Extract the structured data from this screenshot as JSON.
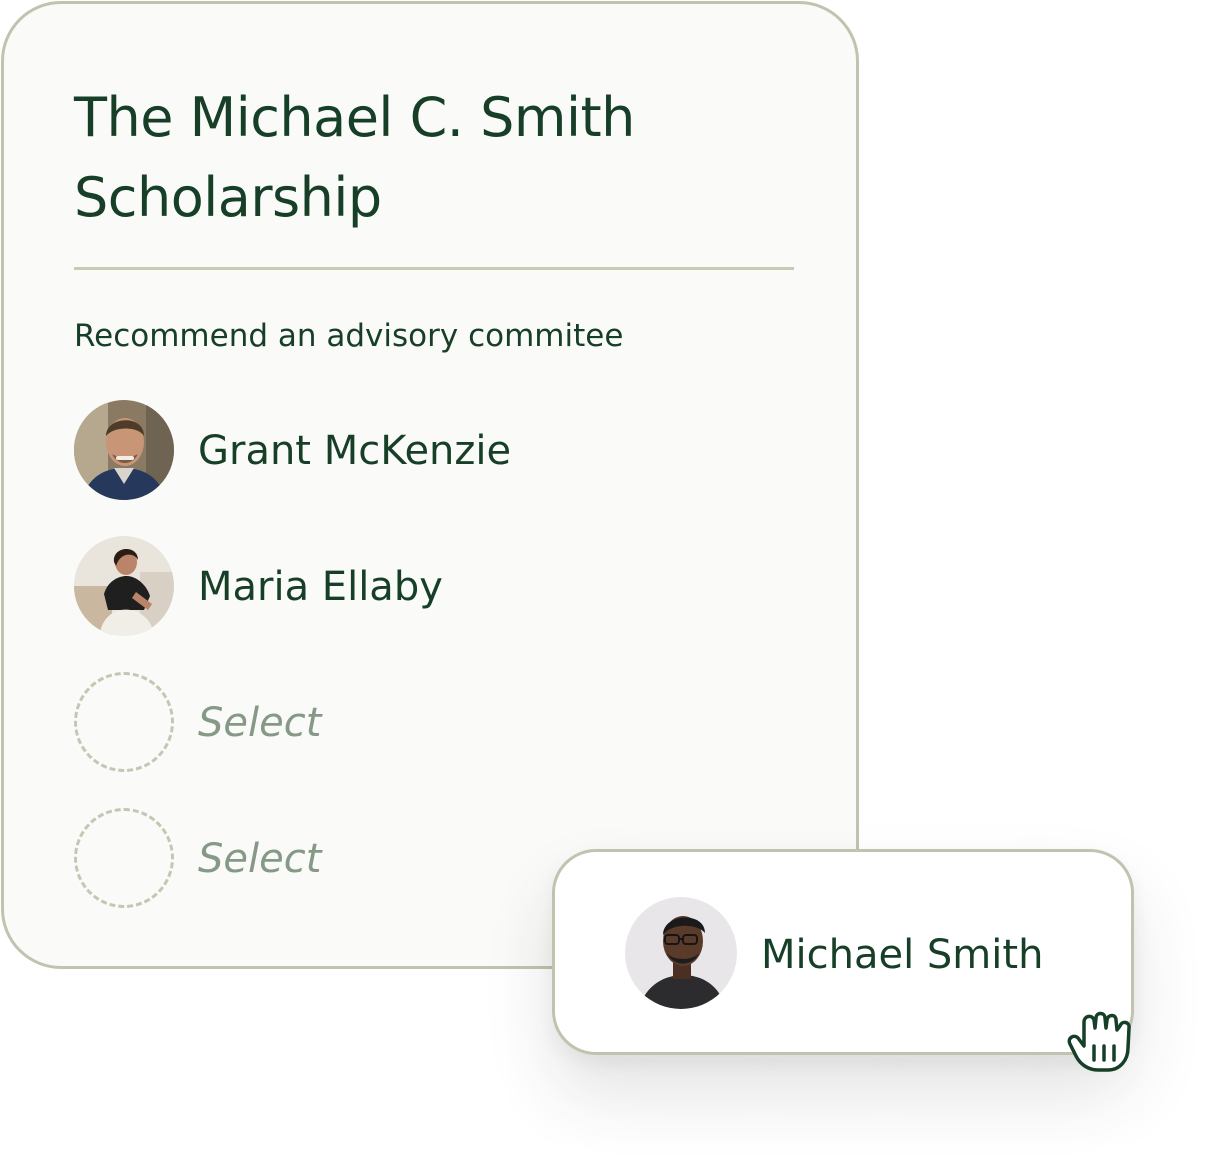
{
  "card": {
    "title": "The Michael C. Smith Scholarship",
    "subtitle": "Recommend an advisory commitee",
    "members": [
      {
        "name": "Grant McKenzie",
        "avatar_icon": "avatar-photo"
      },
      {
        "name": "Maria Ellaby",
        "avatar_icon": "avatar-photo"
      }
    ],
    "empty_slots": [
      {
        "label": "Select"
      },
      {
        "label": "Select"
      }
    ]
  },
  "dragged_item": {
    "name": "Michael Smith",
    "avatar_icon": "avatar-photo",
    "cursor_icon": "grab-hand-icon"
  },
  "colors": {
    "primary_text": "#173f28",
    "placeholder_text": "#869986",
    "border": "#c2c3ae",
    "card_background": "#fafaf8"
  }
}
